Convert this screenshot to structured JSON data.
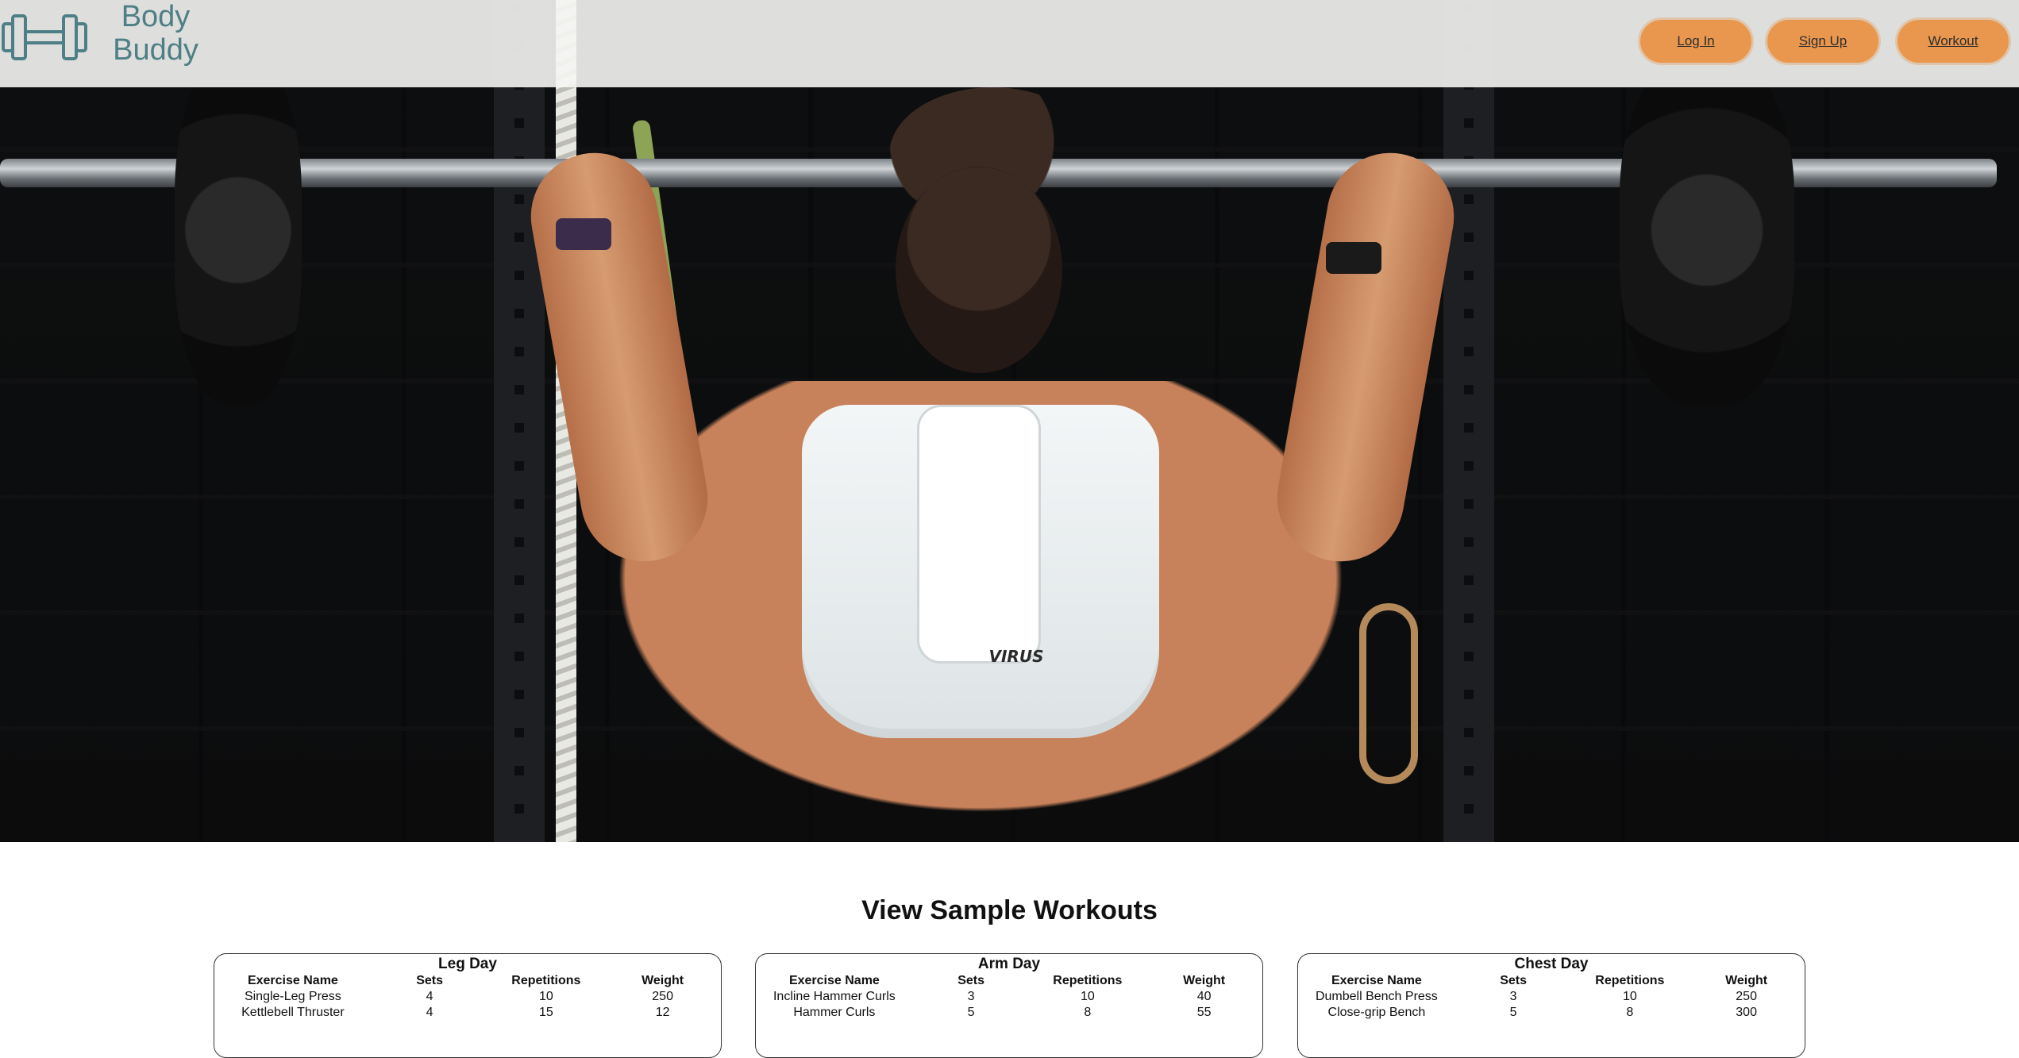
{
  "brand": {
    "line1": "Body",
    "line2": "Buddy",
    "logo_icon": "dumbbell-icon",
    "color": "#4e7f86"
  },
  "nav": {
    "buttons": [
      {
        "label": "Log In"
      },
      {
        "label": "Sign Up"
      },
      {
        "label": "Workout"
      }
    ],
    "button_color": "#e9974e"
  },
  "hero": {
    "print_text": "VIRUS"
  },
  "section": {
    "title": "View Sample Workouts"
  },
  "columns": [
    "Exercise Name",
    "Sets",
    "Repetitions",
    "Weight"
  ],
  "workouts": [
    {
      "title": "Leg Day",
      "rows": [
        {
          "name": "Single-Leg Press",
          "sets": "4",
          "reps": "10",
          "weight": "250"
        },
        {
          "name": "Kettlebell Thruster",
          "sets": "4",
          "reps": "15",
          "weight": "12"
        }
      ]
    },
    {
      "title": "Arm Day",
      "rows": [
        {
          "name": "Incline Hammer Curls",
          "sets": "3",
          "reps": "10",
          "weight": "40"
        },
        {
          "name": "Hammer Curls",
          "sets": "5",
          "reps": "8",
          "weight": "55"
        }
      ]
    },
    {
      "title": "Chest Day",
      "rows": [
        {
          "name": "Dumbell Bench Press",
          "sets": "3",
          "reps": "10",
          "weight": "250"
        },
        {
          "name": "Close-grip Bench",
          "sets": "5",
          "reps": "8",
          "weight": "300"
        }
      ]
    }
  ]
}
